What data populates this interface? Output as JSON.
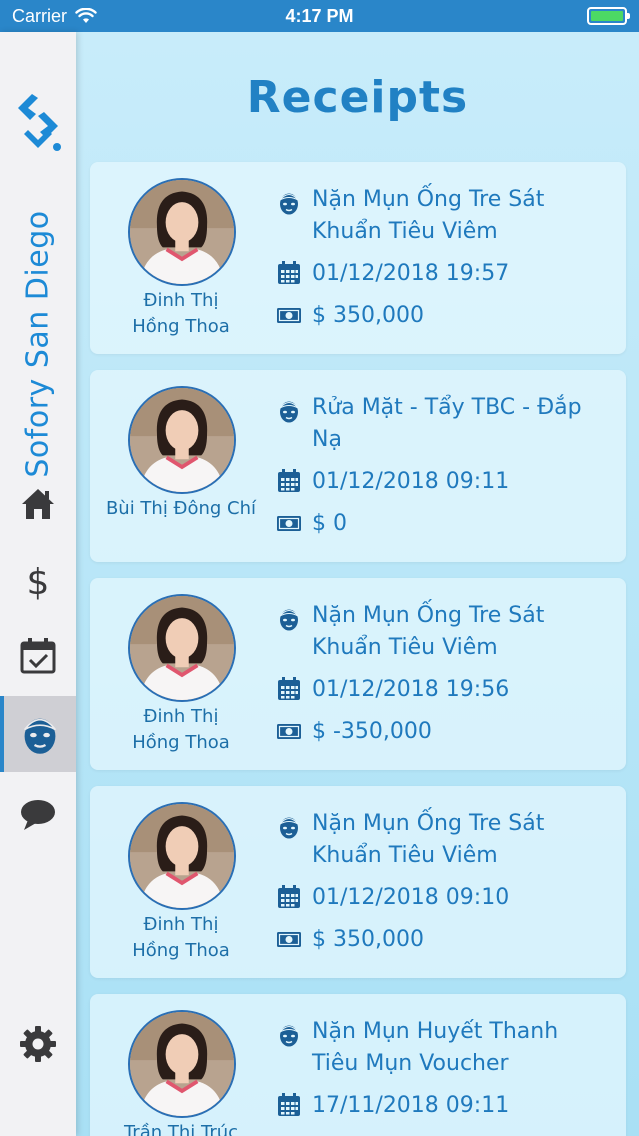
{
  "status_bar": {
    "carrier": "Carrier",
    "time": "4:17 PM"
  },
  "sidebar": {
    "brand": "Sofory San Diego",
    "nav": [
      {
        "icon": "home-icon"
      },
      {
        "icon": "dollar-icon"
      },
      {
        "icon": "calendar-check-icon"
      },
      {
        "icon": "facial-mask-icon",
        "active": true
      },
      {
        "icon": "chat-bubble-icon"
      },
      {
        "icon": "gear-icon"
      }
    ]
  },
  "page": {
    "title": "Receipts"
  },
  "receipts": [
    {
      "staff": "Đinh Thị\nHồng Thoa",
      "service": "Nặn Mụn Ống Tre Sát Khuẩn Tiêu Viêm",
      "datetime": "01/12/2018 19:57",
      "amount": "$ 350,000"
    },
    {
      "staff": "Bùi Thị Đông Chí",
      "service": "Rửa Mặt - Tẩy TBC - Đắp Nạ",
      "datetime": "01/12/2018 09:11",
      "amount": "$ 0"
    },
    {
      "staff": "Đinh Thị\nHồng Thoa",
      "service": "Nặn Mụn Ống Tre Sát Khuẩn Tiêu Viêm",
      "datetime": "01/12/2018 19:56",
      "amount": "$ -350,000"
    },
    {
      "staff": "Đinh Thị\nHồng Thoa",
      "service": "Nặn Mụn Ống Tre Sát Khuẩn Tiêu Viêm",
      "datetime": "01/12/2018 09:10",
      "amount": "$ 350,000"
    },
    {
      "staff": "Trần Thị Trúc",
      "service": "Nặn Mụn Huyết Thanh Tiêu Mụn Voucher",
      "datetime": "17/11/2018 09:11",
      "amount": ""
    }
  ],
  "colors": {
    "accent": "#2181c4",
    "status_bar": "#2a86c9",
    "battery": "#4cd964"
  }
}
